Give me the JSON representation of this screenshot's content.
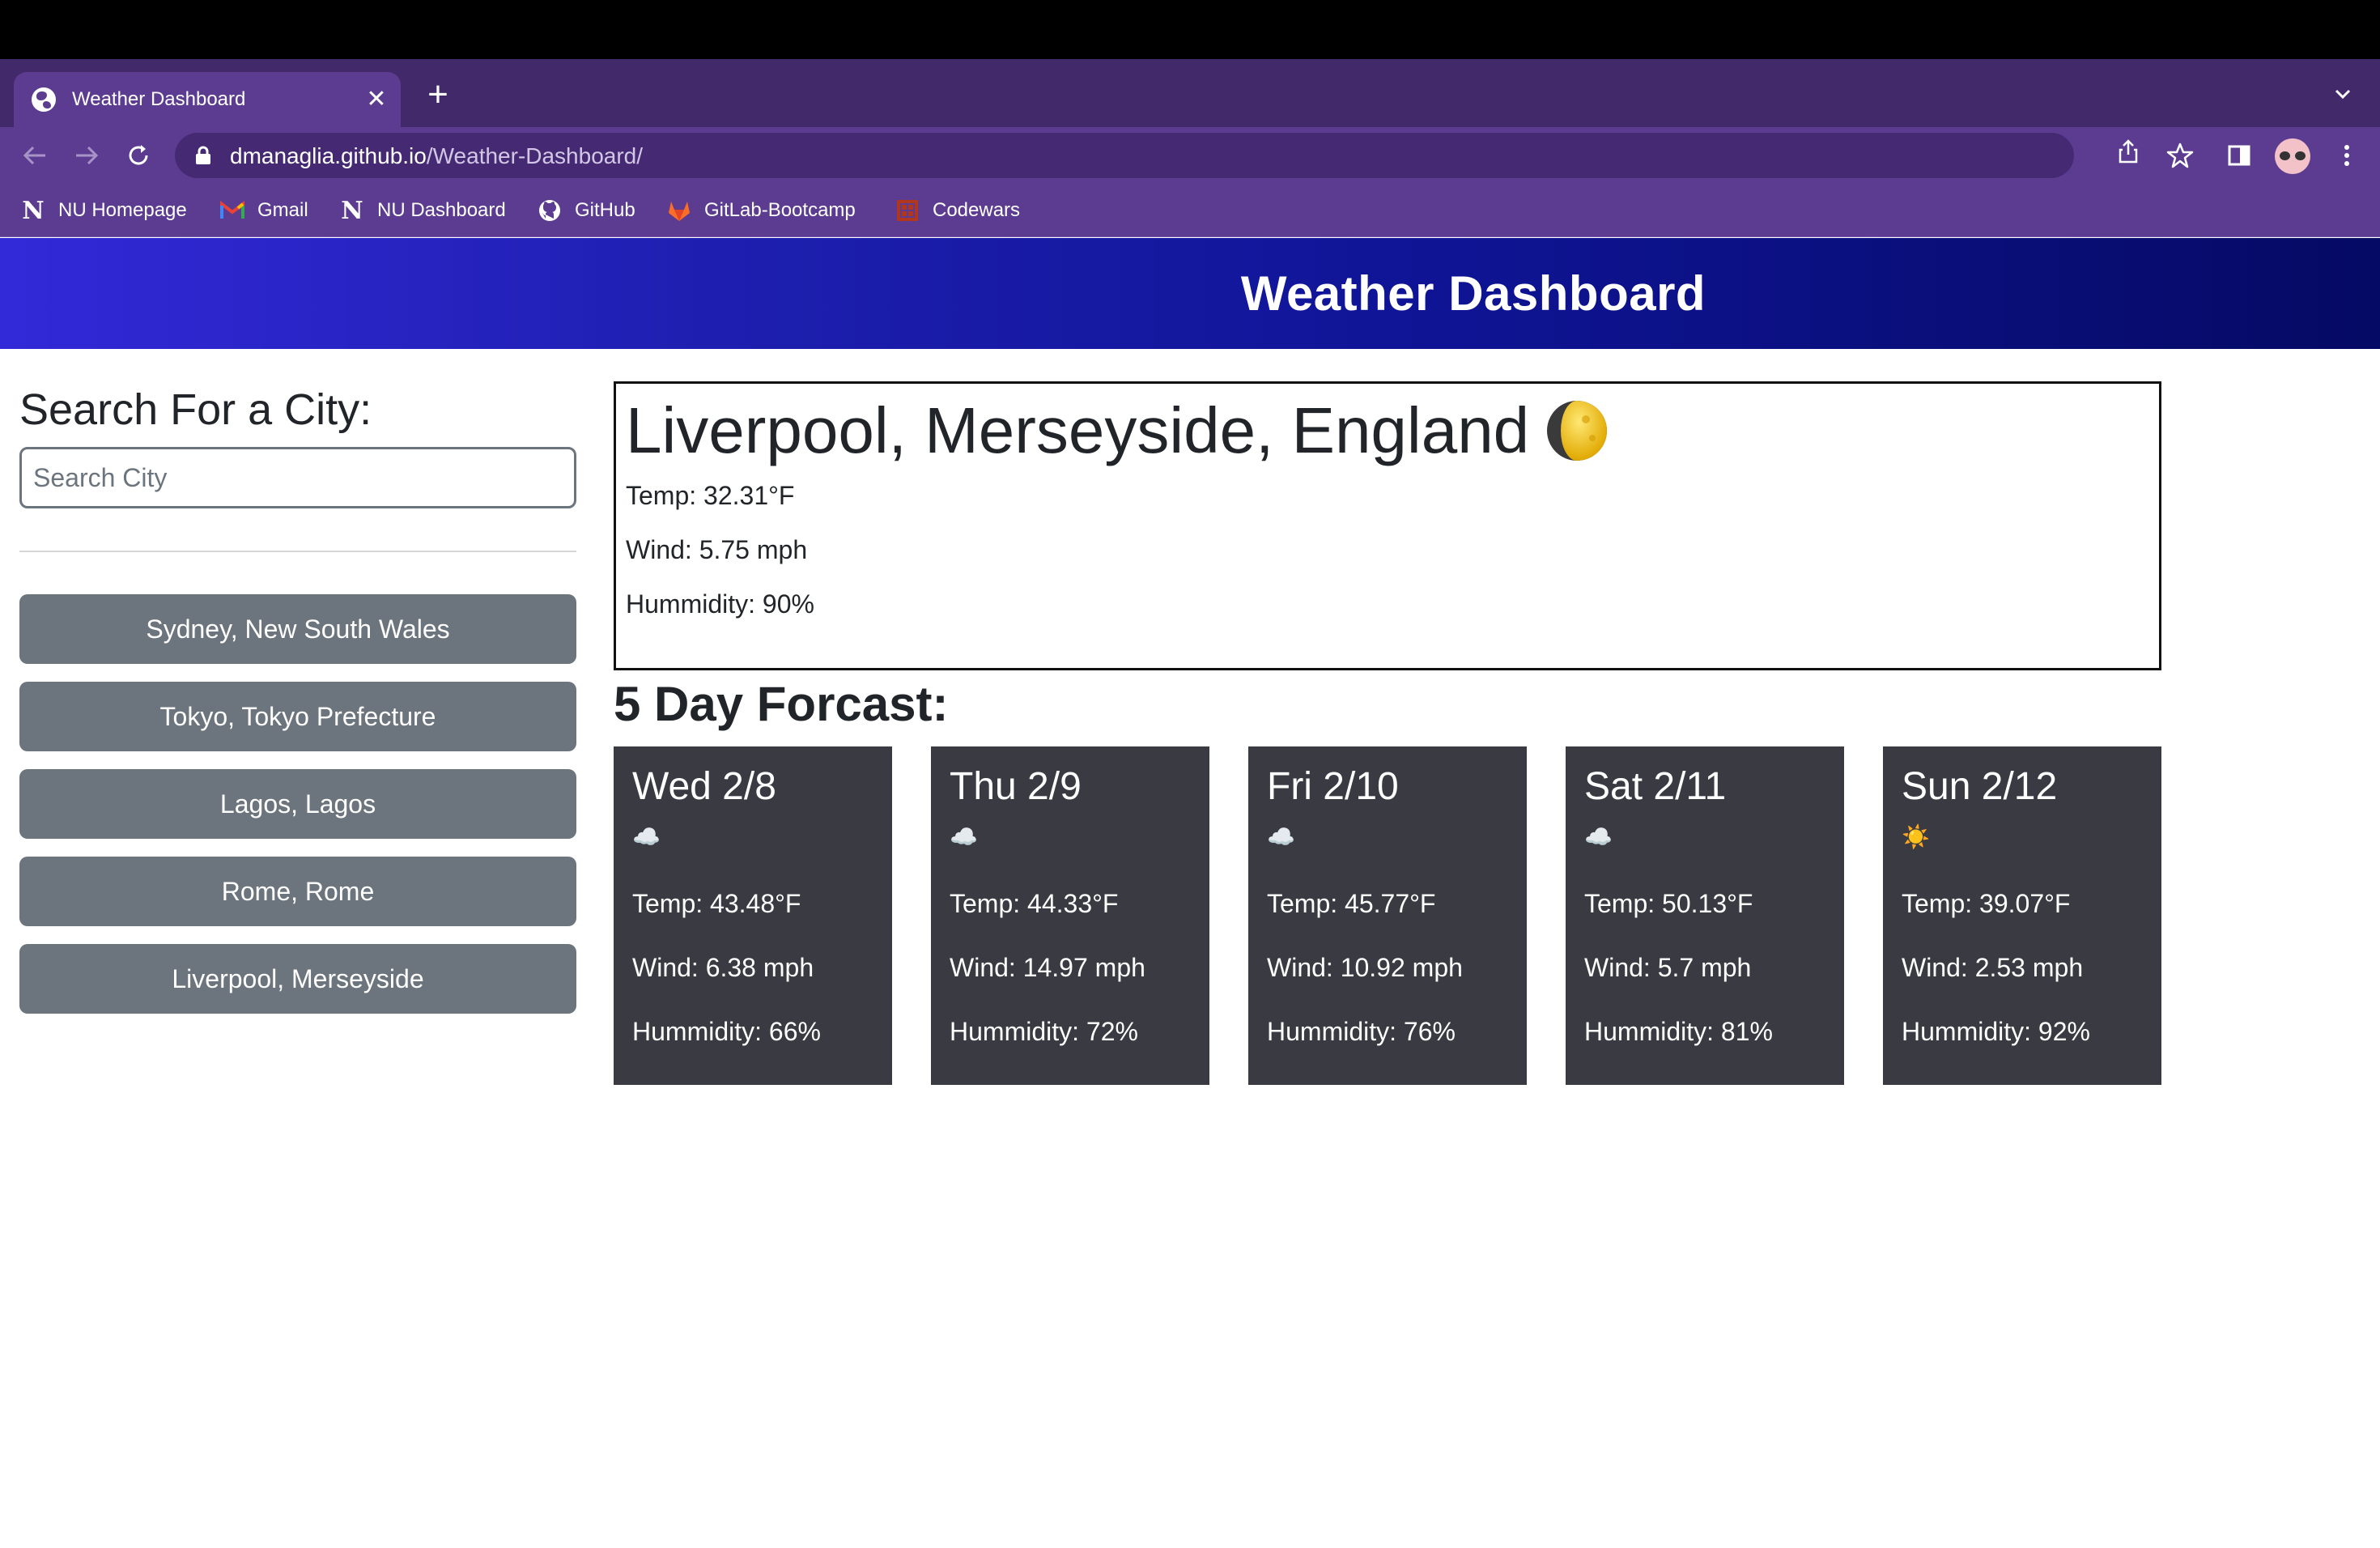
{
  "browser": {
    "tab_title": "Weather Dashboard",
    "url_domain": "dmanaglia.github.io",
    "url_path": "/Weather-Dashboard/",
    "bookmarks": [
      {
        "label": "NU Homepage",
        "icon": "northeastern-n-icon"
      },
      {
        "label": "Gmail",
        "icon": "gmail-icon"
      },
      {
        "label": "NU Dashboard",
        "icon": "northeastern-n-icon"
      },
      {
        "label": "GitHub",
        "icon": "github-icon"
      },
      {
        "label": "GitLab-Bootcamp",
        "icon": "gitlab-icon"
      },
      {
        "label": "Codewars",
        "icon": "codewars-icon"
      }
    ],
    "colors": {
      "tabstrip": "#42296a",
      "toolbar": "#5c3c91"
    }
  },
  "header": {
    "title": "Weather Dashboard"
  },
  "sidebar": {
    "heading": "Search For a City:",
    "search_placeholder": "Search City",
    "search_value": "",
    "history": [
      "Sydney, New South Wales",
      "Tokyo, Tokyo Prefecture",
      "Lagos, Lagos",
      "Rome, Rome",
      "Liverpool, Merseyside"
    ]
  },
  "current": {
    "city": "Liverpool, Merseyside, England",
    "icon": "waxing-gibbous-moon-icon",
    "temp": "Temp: 32.31°F",
    "wind": "Wind: 5.75 mph",
    "humidity": "Hummidity: 90%"
  },
  "forecast": {
    "title": "5 Day Forcast:",
    "days": [
      {
        "date": "Wed 2/8",
        "icon": "☁️",
        "temp": "Temp: 43.48°F",
        "wind": "Wind: 6.38 mph",
        "humidity": "Hummidity: 66%"
      },
      {
        "date": "Thu 2/9",
        "icon": "☁️",
        "temp": "Temp: 44.33°F",
        "wind": "Wind: 14.97 mph",
        "humidity": "Hummidity: 72%"
      },
      {
        "date": "Fri 2/10",
        "icon": "☁️",
        "temp": "Temp: 45.77°F",
        "wind": "Wind: 10.92 mph",
        "humidity": "Hummidity: 76%"
      },
      {
        "date": "Sat 2/11",
        "icon": "☁️",
        "temp": "Temp: 50.13°F",
        "wind": "Wind: 5.7 mph",
        "humidity": "Hummidity: 81%"
      },
      {
        "date": "Sun 2/12",
        "icon": "☀️",
        "temp": "Temp: 39.07°F",
        "wind": "Wind: 2.53 mph",
        "humidity": "Hummidity: 92%"
      }
    ]
  },
  "colors": {
    "header_start": "#3229d8",
    "header_end": "#050a64",
    "city_button": "#6c757d",
    "card": "#393a42"
  }
}
